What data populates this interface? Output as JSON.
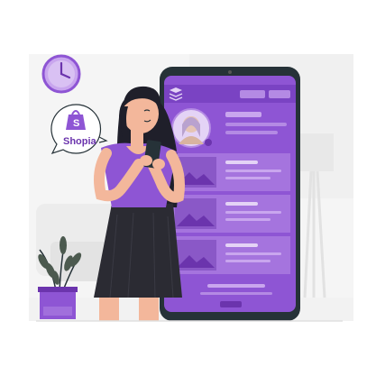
{
  "speech_bubble": {
    "brand_name": "Shopia",
    "icon": "shopping-bag-icon"
  },
  "colors": {
    "accent": "#8e55d4",
    "accent_dark": "#6b34ad",
    "accent_light": "#c9a6ee",
    "accent_pale": "#e4d3f6",
    "skin": "#f3b79b",
    "hair": "#1f1f2a",
    "skirt": "#2b2b33",
    "wall": "#f6f6f6",
    "outline": "#263238"
  },
  "phone": {
    "header_icon": "layers-icon",
    "list_item_count": 3
  },
  "icons": [
    "clock-icon",
    "plant-icon",
    "image-placeholder-icon",
    "layers-icon",
    "shopping-bag-icon"
  ]
}
